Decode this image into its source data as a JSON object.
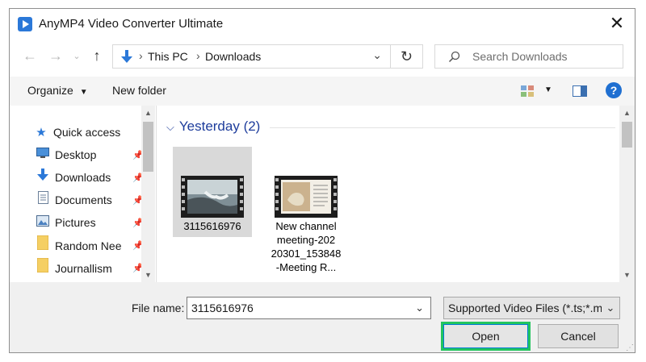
{
  "window": {
    "title": "AnyMP4 Video Converter Ultimate"
  },
  "address": {
    "path": [
      "This PC",
      "Downloads"
    ],
    "separator": "›"
  },
  "search": {
    "placeholder": "Search Downloads"
  },
  "toolbar": {
    "organize_label": "Organize",
    "new_folder_label": "New folder",
    "help_label": "?"
  },
  "nav": {
    "quick_access": "Quick access",
    "items": [
      {
        "label": "Desktop",
        "icon": "desktop-icon",
        "pinned": true
      },
      {
        "label": "Downloads",
        "icon": "downloads-icon",
        "pinned": true
      },
      {
        "label": "Documents",
        "icon": "documents-icon",
        "pinned": true
      },
      {
        "label": "Pictures",
        "icon": "pictures-icon",
        "pinned": true
      },
      {
        "label": "Random Nee",
        "icon": "folder-icon",
        "pinned": true
      },
      {
        "label": "Journallism",
        "icon": "folder-icon",
        "pinned": true
      }
    ]
  },
  "files": {
    "group_label": "Yesterday (2)",
    "items": [
      {
        "name": "3115616976",
        "selected": true
      },
      {
        "name": "New channel meeting-20220301_153848-Meeting R...",
        "lines": [
          "New channel",
          "meeting-202",
          "20301_153848",
          "-Meeting R..."
        ],
        "selected": false
      }
    ]
  },
  "footer": {
    "filename_label": "File name:",
    "filename_value": "3115616976",
    "filetype_value": "Supported Video Files (*.ts;*.mt",
    "open_label": "Open",
    "cancel_label": "Cancel"
  },
  "colors": {
    "accent": "#2b78d8",
    "group_header": "#1e3d9c",
    "highlight": "#22c55e"
  }
}
